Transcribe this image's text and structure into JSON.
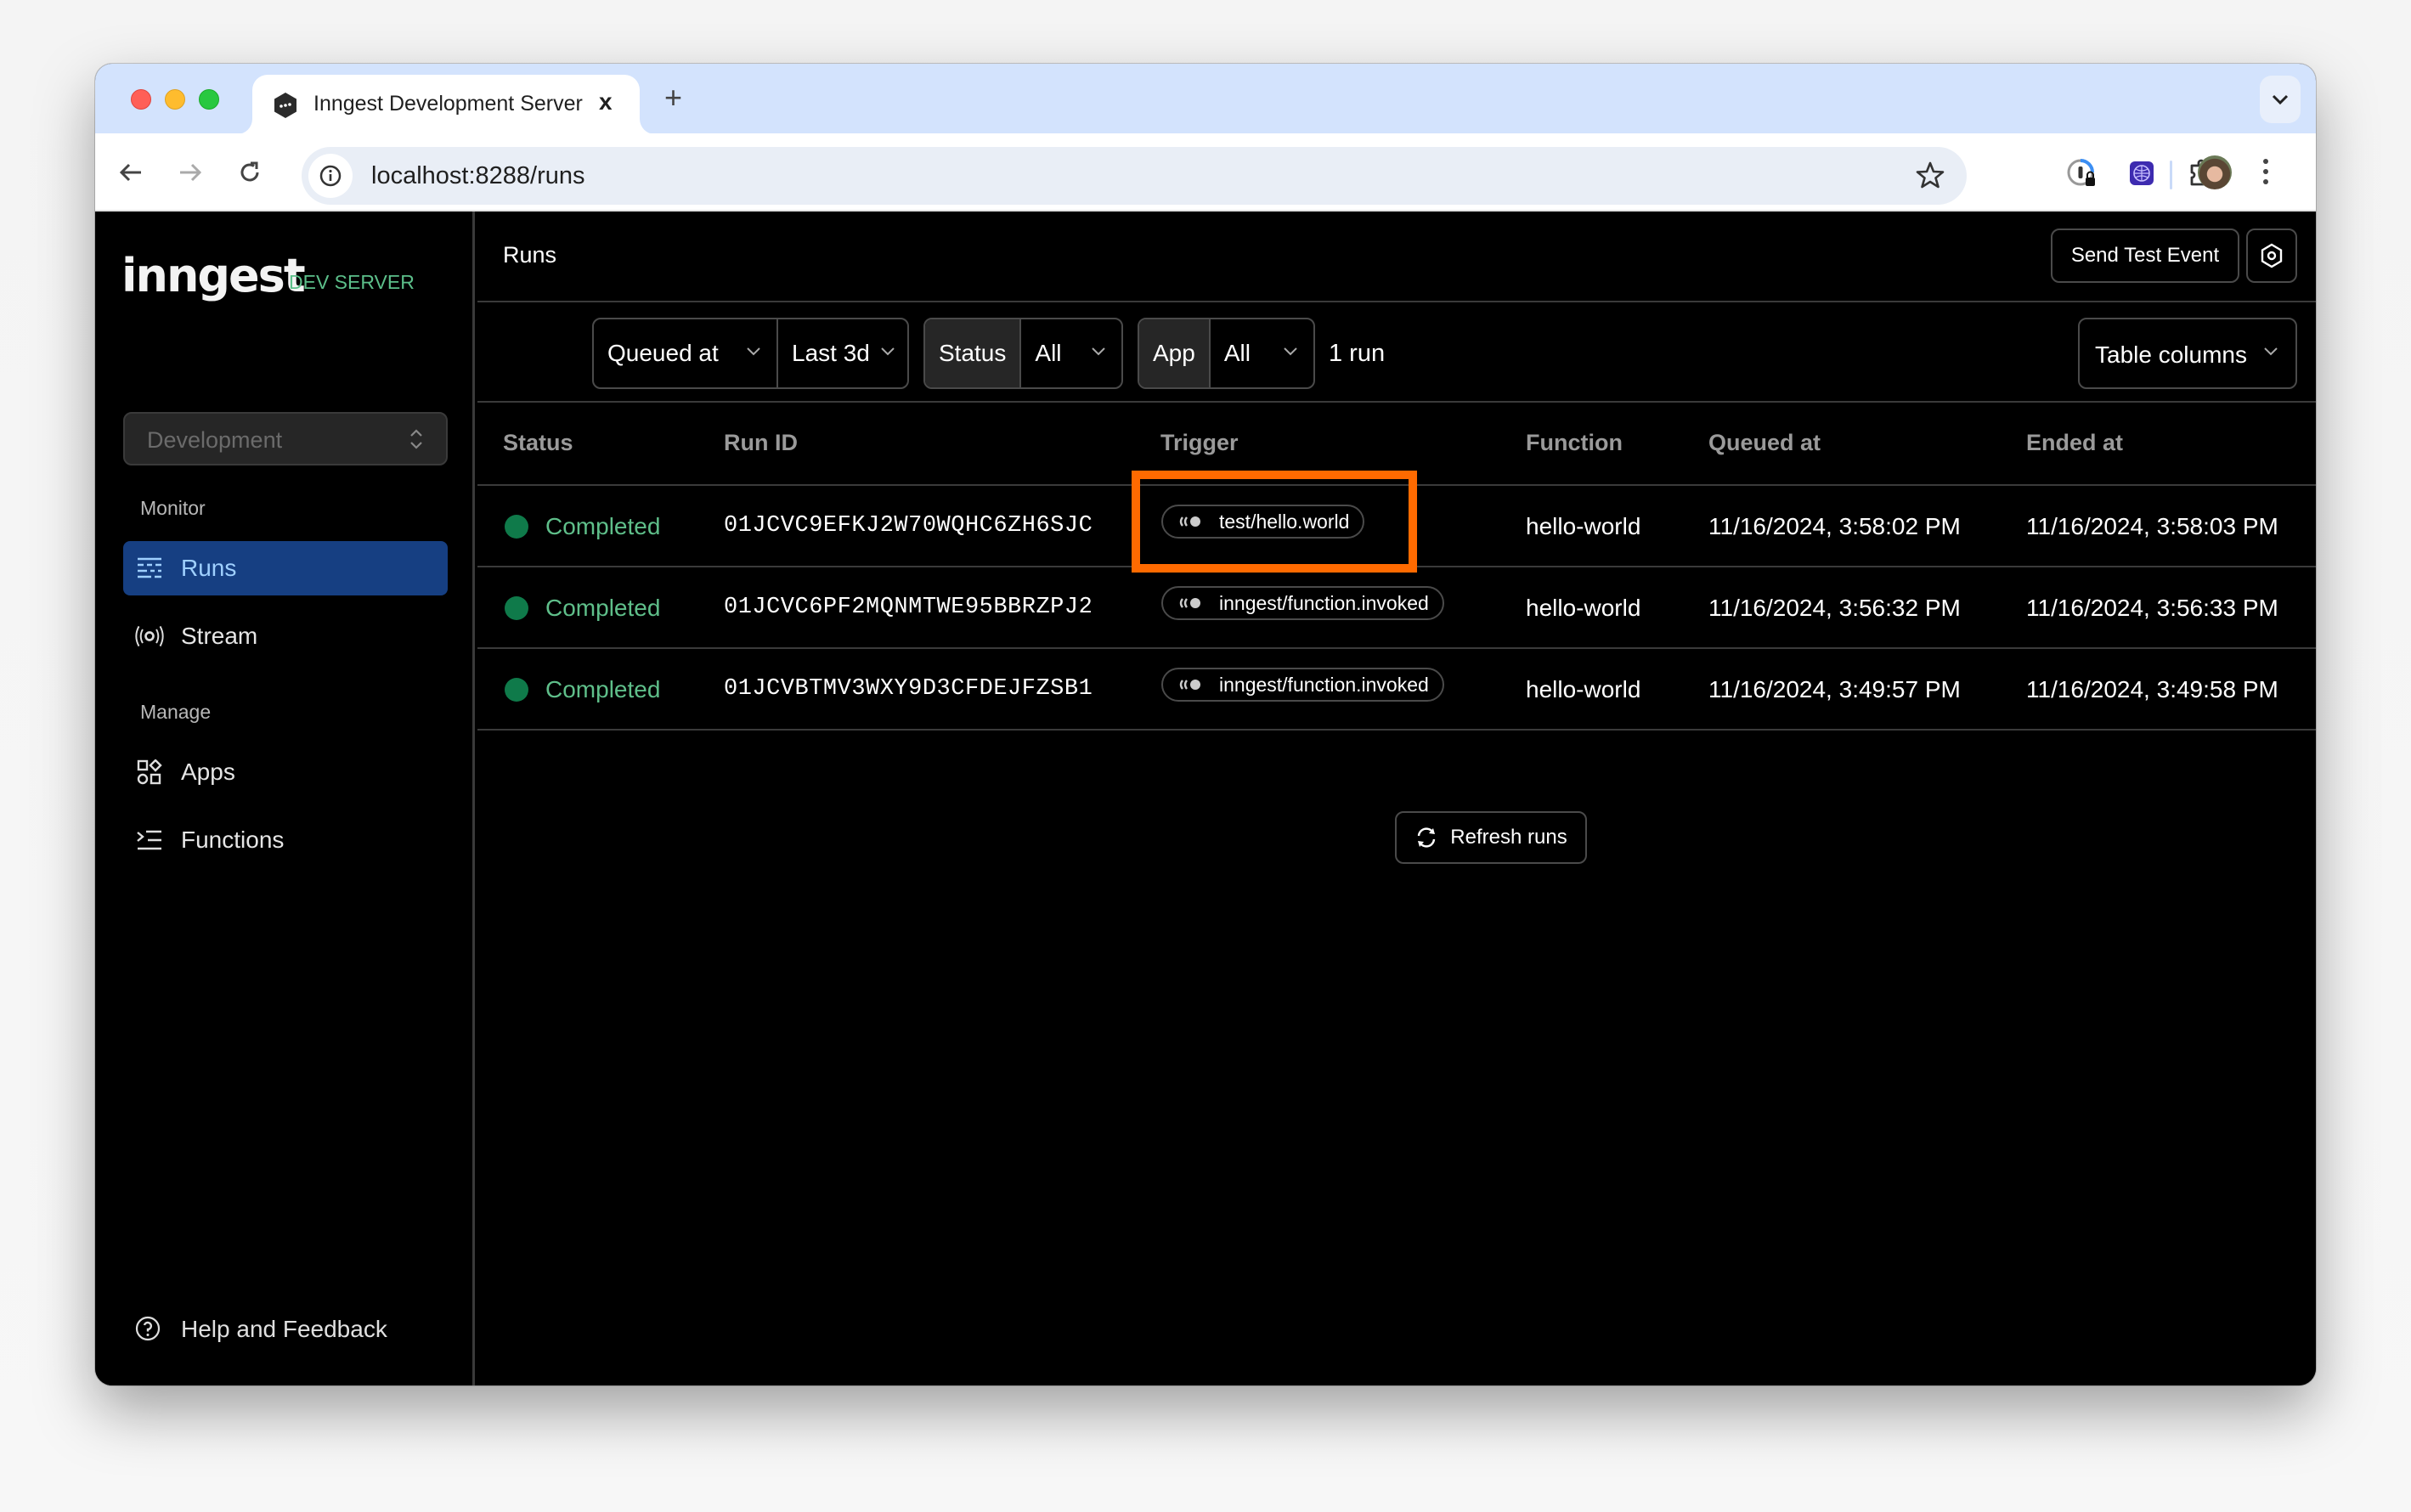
{
  "browser": {
    "tab_title": "Inngest Development Server",
    "tab_close": "x",
    "new_tab": "+",
    "url": "localhost:8288/runs"
  },
  "sidebar": {
    "logo": "inngest",
    "logo_tag": "DEV SERVER",
    "environment": "Development",
    "sections": [
      {
        "label": "Monitor",
        "items": [
          {
            "label": "Runs",
            "icon": "runs-icon",
            "active": true
          },
          {
            "label": "Stream",
            "icon": "stream-icon"
          }
        ]
      },
      {
        "label": "Manage",
        "items": [
          {
            "label": "Apps",
            "icon": "apps-icon"
          },
          {
            "label": "Functions",
            "icon": "functions-icon"
          }
        ]
      }
    ],
    "help": "Help and Feedback"
  },
  "header": {
    "title": "Runs",
    "send_test_event": "Send Test Event"
  },
  "filters": {
    "time_field": "Queued at",
    "time_range": "Last 3d",
    "status_key": "Status",
    "status_value": "All",
    "app_key": "App",
    "app_value": "All",
    "run_count": "1 run",
    "table_columns": "Table columns"
  },
  "table": {
    "columns": [
      "Status",
      "Run ID",
      "Trigger",
      "Function",
      "Queued at",
      "Ended at"
    ],
    "rows": [
      {
        "status": "Completed",
        "run_id": "01JCVC9EFKJ2W70WQHC6ZH6SJC",
        "trigger": "test/hello.world",
        "function": "hello-world",
        "queued_at": "11/16/2024, 3:58:02 PM",
        "ended_at": "11/16/2024, 3:58:03 PM"
      },
      {
        "status": "Completed",
        "run_id": "01JCVC6PF2MQNMTWE95BBRZPJ2",
        "trigger": "inngest/function.invoked",
        "function": "hello-world",
        "queued_at": "11/16/2024, 3:56:32 PM",
        "ended_at": "11/16/2024, 3:56:33 PM"
      },
      {
        "status": "Completed",
        "run_id": "01JCVBTMV3WXY9D3CFDEJFZSB1",
        "trigger": "inngest/function.invoked",
        "function": "hello-world",
        "queued_at": "11/16/2024, 3:49:57 PM",
        "ended_at": "11/16/2024, 3:49:58 PM"
      }
    ],
    "refresh": "Refresh runs"
  },
  "colors": {
    "accent_active": "#163f82",
    "status_completed_dot": "#0f7a4a",
    "status_completed_text": "#5fbf8a",
    "highlight": "#ff6a00",
    "dev_server_tag": "#5cbf8a"
  }
}
